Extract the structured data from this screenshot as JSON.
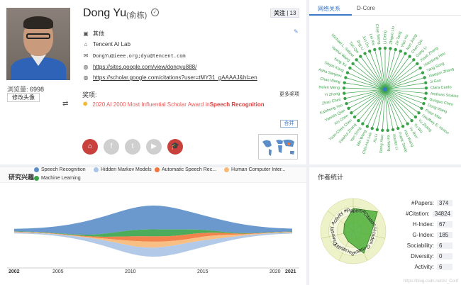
{
  "profile": {
    "name": "Dong Yu",
    "name_cn": "(俞栋)",
    "follow_label": "关注",
    "follow_count": "13",
    "affiliation_type": "其他",
    "organization": "Tencent AI Lab",
    "email": "DongYu@ieee.org;dyu@tencent.com",
    "homepage": "https://sites.google.com/view/dongyu888/",
    "scholar": "https://scholar.google.com/citations?user=tMY31_gAAAAJ&hl=en",
    "views_label": "浏览量:",
    "views": "6998",
    "edit_avatar": "修改头像",
    "awards_title": "奖项:",
    "more_awards": "更多奖项",
    "award_prefix": "2020 AI 2000 Most Influential Scholar Award in ",
    "award_highlight": "Speech Recognition",
    "collapse": "合并",
    "socials": [
      {
        "icon": "home-icon",
        "glyph": "⌂",
        "color": "#c9413d"
      },
      {
        "icon": "facebook-icon",
        "glyph": "f",
        "color": "#cfcfcf"
      },
      {
        "icon": "twitter-icon",
        "glyph": "t",
        "color": "#cfcfcf"
      },
      {
        "icon": "youtube-icon",
        "glyph": "▶",
        "color": "#cfcfcf"
      },
      {
        "icon": "graduation-cap-icon",
        "glyph": "🎓",
        "color": "#c9413d"
      }
    ]
  },
  "network": {
    "tabs": [
      "网络关系",
      "D-Core"
    ],
    "names": [
      "Li Deng",
      "Zhiguo Liu",
      "Jie Tang",
      "Yibo Hu",
      "Nan Jiang",
      "Chen Qin",
      "Gang Li",
      "Xiaoli Zhang",
      "Xiaodong Hou",
      "Yang Song",
      "Xiaoyun Zhang",
      "Ji Guo",
      "Clara Cardo",
      "Andreas Stolcke",
      "Guoguo Chen",
      "Dong Wang",
      "Peter Mao",
      "Geoffrey E. Hinton",
      "Yu Zhang",
      "Yu Wu",
      "Yu Ren",
      "Hao Wang",
      "Frank Seide",
      "Xiaofei Li",
      "Xin Wang",
      "Xiong Xiao",
      "Xu Li",
      "Chin-Hui Lee",
      "Mei Wang",
      "Yan Song",
      "Xiaohui Zhang",
      "Yuan-Chen Chen",
      "Xin Chen",
      "Yanmin Qian",
      "Kaisheng Yao",
      "Zhao Chen",
      "Yi Zhang",
      "Helen Meng",
      "Chao Wang",
      "Asha Sanjeev",
      "Shiyin Kang",
      "Yong Xu",
      "Yanhui Wang",
      "Michael L. Seltzer",
      "Tao Qin",
      "Jing Li",
      "Jun Du",
      "Lei Xie",
      "Chao Weng"
    ]
  },
  "interests": {
    "title": "研究兴趣",
    "legend": [
      {
        "label": "Speech Recognition",
        "color": "#5b8ec8"
      },
      {
        "label": "Hidden Markov Models",
        "color": "#aac4e6"
      },
      {
        "label": "Automatic Speech Rec...",
        "color": "#f2753a"
      },
      {
        "label": "Human Computer Inter...",
        "color": "#f7b878"
      },
      {
        "label": "Machine Learning",
        "color": "#3aa34a"
      }
    ],
    "axis": {
      "start": "2002",
      "ticks": [
        "2005",
        "2010",
        "2015",
        "2020"
      ],
      "end": "2021"
    }
  },
  "stats": {
    "title": "作者统计",
    "radar_labels": [
      "#Papers",
      "#Citation",
      "H-Index",
      "G-Index",
      "Sociability",
      "Diversity",
      "Activity"
    ],
    "radar_values": [
      0.7,
      0.95,
      0.55,
      0.75,
      0.35,
      0.3,
      0.35
    ],
    "rows": [
      {
        "label": "#Papers:",
        "value": "374"
      },
      {
        "label": "#Citation:",
        "value": "34824"
      },
      {
        "label": "H-Index:",
        "value": "67"
      },
      {
        "label": "G-Index:",
        "value": "185"
      },
      {
        "label": "Sociability:",
        "value": "6"
      },
      {
        "label": "Diversity:",
        "value": "0"
      },
      {
        "label": "Activity:",
        "value": "6"
      }
    ],
    "watermark": "https://blog.csdn.net/AI_Conf"
  },
  "colors": {
    "accent": "#3a78c8",
    "network_green": "#3aa34a",
    "award_red": "#e03a3a"
  }
}
